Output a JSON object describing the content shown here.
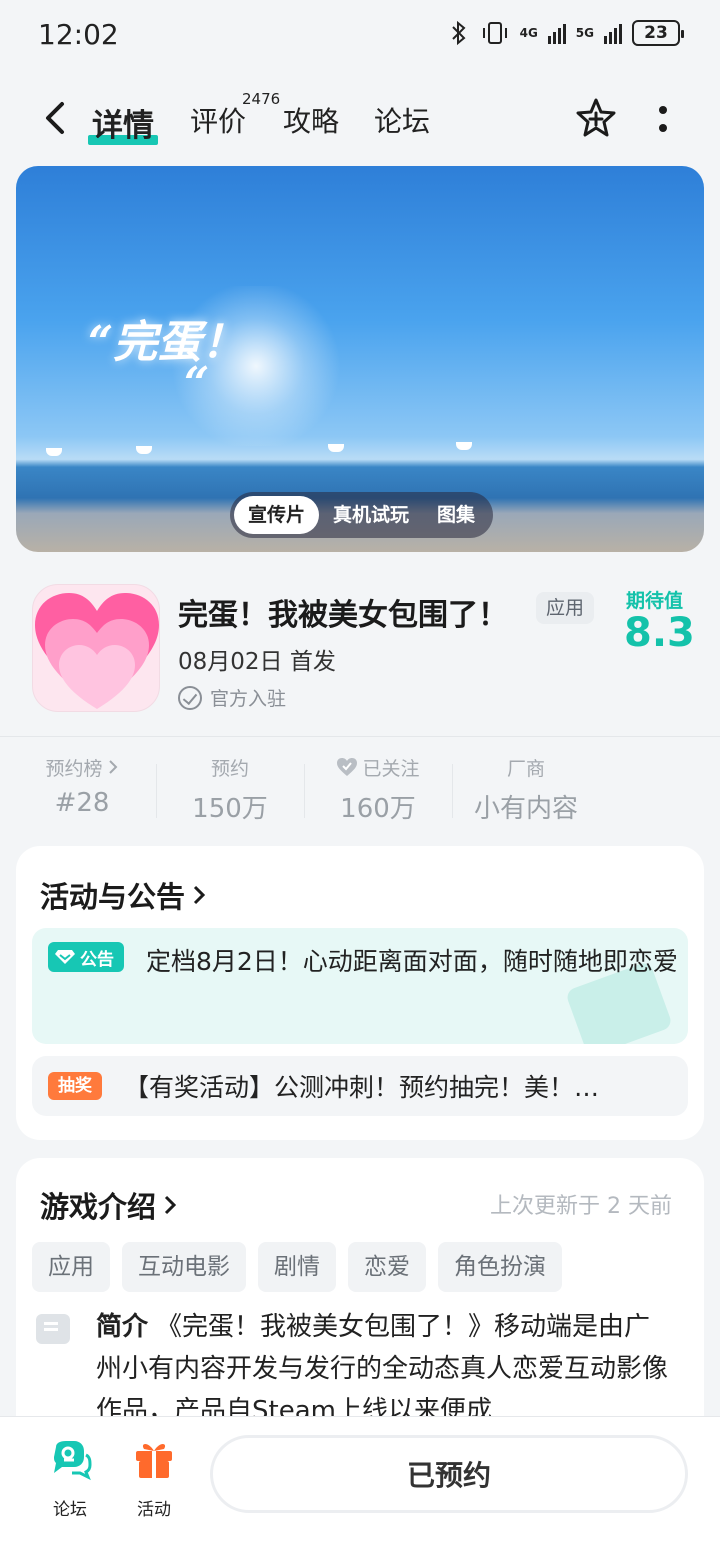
{
  "status_bar": {
    "time": "12:02",
    "network_1": "4G",
    "network_2": "5G",
    "battery": "23"
  },
  "nav": {
    "tabs": [
      {
        "label": "详情",
        "active": true
      },
      {
        "label": "评价",
        "badge": "2476"
      },
      {
        "label": "攻略"
      },
      {
        "label": "论坛"
      }
    ]
  },
  "banner": {
    "slogan": "“完蛋！",
    "slogan_quote": "“",
    "segments": [
      "宣传片",
      "真机试玩",
      "图集"
    ],
    "selected_segment": "宣传片"
  },
  "app": {
    "name": "完蛋！我被美女包围了！",
    "tag": "应用",
    "release": "08月02日 首发",
    "official": "官方入驻",
    "expect_label": "期待值",
    "expect_value": "8.3",
    "accent_color": "#14c2aa"
  },
  "stats": [
    {
      "label": "预约榜",
      "value": "#28",
      "icon": "chevron-right-icon"
    },
    {
      "label": "预约",
      "value": "150万"
    },
    {
      "label": "已关注",
      "value": "160万",
      "icon": "heart-icon"
    },
    {
      "label": "厂商",
      "value": "小有内容"
    }
  ],
  "events": {
    "title": "活动与公告",
    "notice_tag": "公告",
    "notice_text": "定档8月2日！心动距离面对面，随时随地即恋爱",
    "lottery_tag": "抽奖",
    "lottery_text": "【有奖活动】公测冲刺！预约抽完！美！…"
  },
  "intro": {
    "title": "游戏介绍",
    "updated": "上次更新于 2 天前",
    "tags": [
      "应用",
      "互动电影",
      "剧情",
      "恋爱",
      "角色扮演"
    ],
    "label": "简介",
    "text": "《完蛋！我被美女包围了！》移动端是由广州小有内容开发与发行的全动态真人恋爱互动影像作品，产品自Steam上线以来便成"
  },
  "bottom_bar": {
    "forum": "论坛",
    "activity": "活动",
    "reserve_button": "已预约"
  }
}
